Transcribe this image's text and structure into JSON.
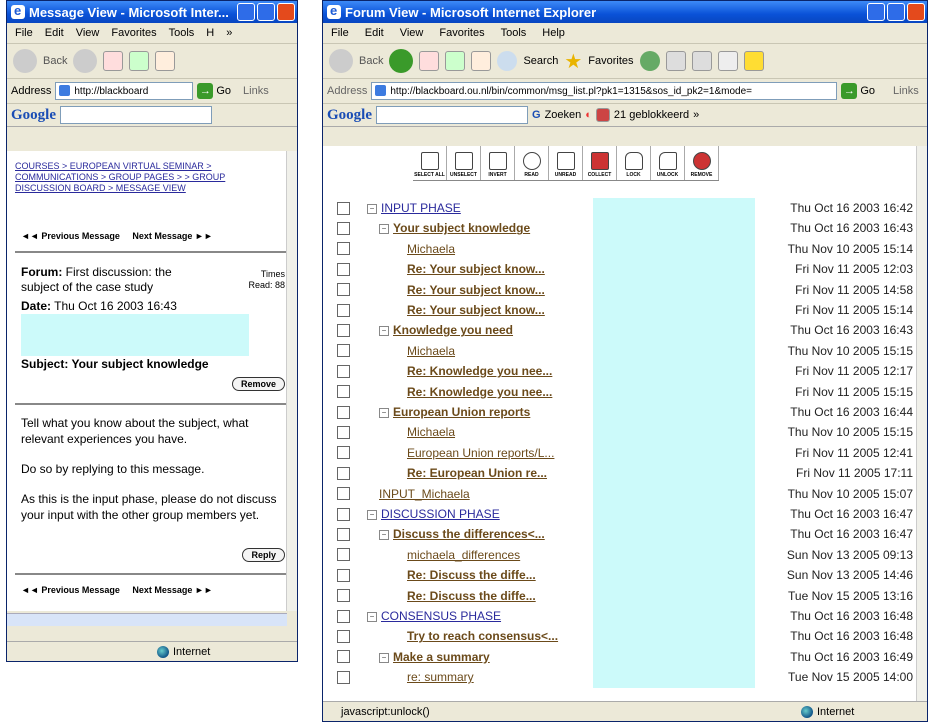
{
  "left": {
    "title": "Message View - Microsoft Inter...",
    "menu": [
      "File",
      "Edit",
      "View",
      "Favorites",
      "Tools",
      "H",
      "»"
    ],
    "back_label": "Back",
    "address_label": "Address",
    "address_value": "http://blackboard",
    "go_label": "Go",
    "links_label": "Links",
    "google_label": "Google",
    "breadcrumb": "COURSES > EUROPEAN VIRTUAL SEMINAR > COMMUNICATIONS > GROUP PAGES > > GROUP DISCUSSION BOARD > MESSAGE VIEW",
    "prev_msg": "◄◄ Previous Message",
    "next_msg": "Next Message ►►",
    "forum_label": "Forum:",
    "forum_value": "First discussion: the subject of the case study",
    "times_label": "Times",
    "read_label": "Read: 88",
    "date_label": "Date:",
    "date_value": "Thu Oct 16 2003 16:43",
    "subject_label": "Subject:",
    "subject_value": "Your subject knowledge",
    "remove_label": "Remove",
    "body_p1": "Tell what you know about the subject, what relevant experiences you have.",
    "body_p2": "Do so by replying to this message.",
    "body_p3": "As this is the input phase, please do not discuss your input with the other group members yet.",
    "reply_label": "Reply",
    "status_zone": "Internet"
  },
  "right": {
    "title": "Forum View - Microsoft Internet Explorer",
    "menu": [
      "File",
      "Edit",
      "View",
      "Favorites",
      "Tools",
      "Help"
    ],
    "back_label": "Back",
    "search_label": "Search",
    "favorites_label": "Favorites",
    "address_label": "Address",
    "address_value": "http://blackboard.ou.nl/bin/common/msg_list.pl?pk1=1315&sos_id_pk2=1&mode=",
    "go_label": "Go",
    "links_label": "Links",
    "google_label": "Google",
    "zoeken_label": "Zoeken",
    "blocked_label": "21 geblokkeerd",
    "more_label": "»",
    "tools": [
      "SELECT ALL",
      "UNSELECT",
      "INVERT",
      "READ",
      "UNREAD",
      "COLLECT",
      "LOCK",
      "UNLOCK",
      "REMOVE"
    ],
    "status_text": "javascript:unlock()",
    "status_zone": "Internet",
    "rows": [
      {
        "text": "INPUT PHASE",
        "date": "Thu Oct 16 2003 16:42",
        "level": 0,
        "exp": true,
        "bold": false,
        "color": "#2a2a9c"
      },
      {
        "text": "Your subject knowledge",
        "date": "Thu Oct 16 2003 16:43",
        "level": 1,
        "exp": true,
        "bold": true,
        "color": "#6b4a1a"
      },
      {
        "text": "Michaela",
        "date": "Thu Nov 10 2005 15:14",
        "level": 2,
        "exp": false,
        "bold": false,
        "color": "#6b4a1a"
      },
      {
        "text": "Re: Your subject know...",
        "date": "Fri Nov 11 2005 12:03",
        "level": 2,
        "exp": false,
        "bold": true,
        "color": "#6b4a1a"
      },
      {
        "text": "Re: Your subject know...",
        "date": "Fri Nov 11 2005 14:58",
        "level": 2,
        "exp": false,
        "bold": true,
        "color": "#6b4a1a"
      },
      {
        "text": "Re: Your subject know...",
        "date": "Fri Nov 11 2005 15:14",
        "level": 2,
        "exp": false,
        "bold": true,
        "color": "#6b4a1a"
      },
      {
        "text": "Knowledge you need",
        "date": "Thu Oct 16 2003 16:43",
        "level": 1,
        "exp": true,
        "bold": true,
        "color": "#6b4a1a"
      },
      {
        "text": "Michaela",
        "date": "Thu Nov 10 2005 15:15",
        "level": 2,
        "exp": false,
        "bold": false,
        "color": "#6b4a1a"
      },
      {
        "text": "Re: Knowledge you nee...",
        "date": "Fri Nov 11 2005 12:17",
        "level": 2,
        "exp": false,
        "bold": true,
        "color": "#6b4a1a"
      },
      {
        "text": "Re: Knowledge you nee...",
        "date": "Fri Nov 11 2005 15:15",
        "level": 2,
        "exp": false,
        "bold": true,
        "color": "#6b4a1a"
      },
      {
        "text": "European Union reports",
        "date": "Thu Oct 16 2003 16:44",
        "level": 1,
        "exp": true,
        "bold": true,
        "color": "#6b4a1a"
      },
      {
        "text": "Michaela",
        "date": "Thu Nov 10 2005 15:15",
        "level": 2,
        "exp": false,
        "bold": false,
        "color": "#6b4a1a"
      },
      {
        "text": "European Union reports/L...",
        "date": "Fri Nov 11 2005 12:41",
        "level": 2,
        "exp": false,
        "bold": false,
        "color": "#6b4a1a"
      },
      {
        "text": "Re: European Union re...",
        "date": "Fri Nov 11 2005 17:11",
        "level": 2,
        "exp": false,
        "bold": true,
        "color": "#6b4a1a"
      },
      {
        "text": "INPUT_Michaela",
        "date": "Thu Nov 10 2005 15:07",
        "level": 1,
        "exp": false,
        "bold": false,
        "color": "#6b4a1a"
      },
      {
        "text": "DISCUSSION PHASE",
        "date": "Thu Oct 16 2003 16:47",
        "level": 0,
        "exp": true,
        "bold": false,
        "color": "#2a2a9c"
      },
      {
        "text": "Discuss the differences<...",
        "date": "Thu Oct 16 2003 16:47",
        "level": 1,
        "exp": true,
        "bold": true,
        "color": "#6b4a1a"
      },
      {
        "text": "michaela_differences",
        "date": "Sun Nov 13 2005 09:13",
        "level": 2,
        "exp": false,
        "bold": false,
        "color": "#6b4a1a"
      },
      {
        "text": "Re: Discuss the diffe...",
        "date": "Sun Nov 13 2005 14:46",
        "level": 2,
        "exp": false,
        "bold": true,
        "color": "#6b4a1a"
      },
      {
        "text": "Re: Discuss the diffe...",
        "date": "Tue Nov 15 2005 13:16",
        "level": 2,
        "exp": false,
        "bold": true,
        "color": "#6b4a1a"
      },
      {
        "text": "CONSENSUS PHASE",
        "date": "Thu Oct 16 2003 16:48",
        "level": 0,
        "exp": true,
        "bold": false,
        "color": "#2a2a9c"
      },
      {
        "text": "Try to reach consensus<...",
        "date": "Thu Oct 16 2003 16:48",
        "level": 2,
        "exp": false,
        "bold": true,
        "color": "#6b4a1a"
      },
      {
        "text": "Make a summary",
        "date": "Thu Oct 16 2003 16:49",
        "level": 1,
        "exp": true,
        "bold": true,
        "color": "#6b4a1a"
      },
      {
        "text": "re: summary",
        "date": "Tue Nov 15 2005 14:00",
        "level": 2,
        "exp": false,
        "bold": false,
        "color": "#6b4a1a"
      }
    ]
  }
}
